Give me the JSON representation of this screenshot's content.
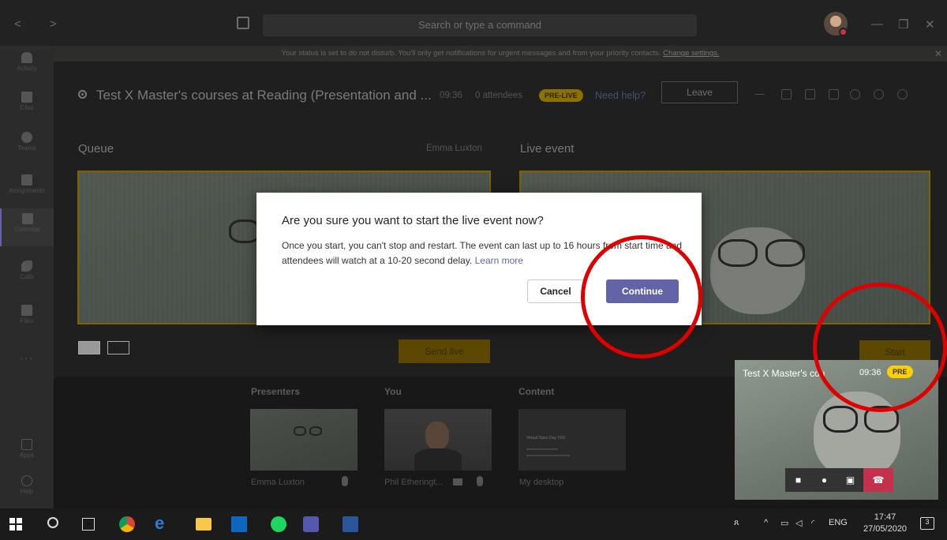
{
  "titlebar": {
    "search_placeholder": "Search or type a command",
    "nav_arrows": "<   >",
    "minimize": "—",
    "restore": "❐",
    "close": "✕"
  },
  "rail": {
    "items": [
      {
        "label": "Activity",
        "icon": "bell-icon"
      },
      {
        "label": "Chat",
        "icon": "chat-icon"
      },
      {
        "label": "Teams",
        "icon": "teams-icon"
      },
      {
        "label": "Assignments",
        "icon": "assignments-icon"
      },
      {
        "label": "Calendar",
        "icon": "calendar-icon"
      },
      {
        "label": "Calls",
        "icon": "phone-icon"
      },
      {
        "label": "Files",
        "icon": "file-icon"
      },
      {
        "label": "Apps",
        "icon": "apps-icon"
      },
      {
        "label": "Help",
        "icon": "help-icon"
      }
    ],
    "more": "..."
  },
  "banner": {
    "text": "Your status is set to do not disturb. You'll only get notifications for urgent messages and from your priority contacts.",
    "link": "Change settings.",
    "close": "✕"
  },
  "event": {
    "title": "Test X Master's courses at Reading (Presentation and ...",
    "time": "09:36",
    "attendees": "0 attendees",
    "status_badge": "PRE-LIVE",
    "help_link": "Need help?",
    "leave_label": "Leave"
  },
  "queue": {
    "label": "Queue",
    "presenter": "Emma Luxton",
    "send_live_label": "Send live"
  },
  "live": {
    "label": "Live event",
    "start_label": "Start"
  },
  "strip": {
    "presenters_label": "Presenters",
    "you_label": "You",
    "content_label": "Content",
    "presenter_name": "Emma Luxton",
    "you_name": "Phil Etheringt...",
    "content_name": "My desktop",
    "content_slide_text": "Virtual Open Day TED"
  },
  "pip": {
    "title": "Test X Master's cou",
    "time": "09:36",
    "badge": "PRE"
  },
  "dialog": {
    "title": "Are you sure you want to start the live event now?",
    "body": "Once you start, you can't stop and restart. The event can last up to 16 hours from start time and attendees will watch at a 10-20 second delay.",
    "learn_more": "Learn more",
    "cancel_label": "Cancel",
    "continue_label": "Continue"
  },
  "taskbar": {
    "language": "ENG",
    "time": "17:47",
    "date": "27/05/2020",
    "notification_count": "3"
  },
  "colors": {
    "teams_purple": "#6264a7",
    "live_yellow": "#ffce00",
    "annotation_red": "#e00000",
    "hangup_red": "#c4314b"
  }
}
